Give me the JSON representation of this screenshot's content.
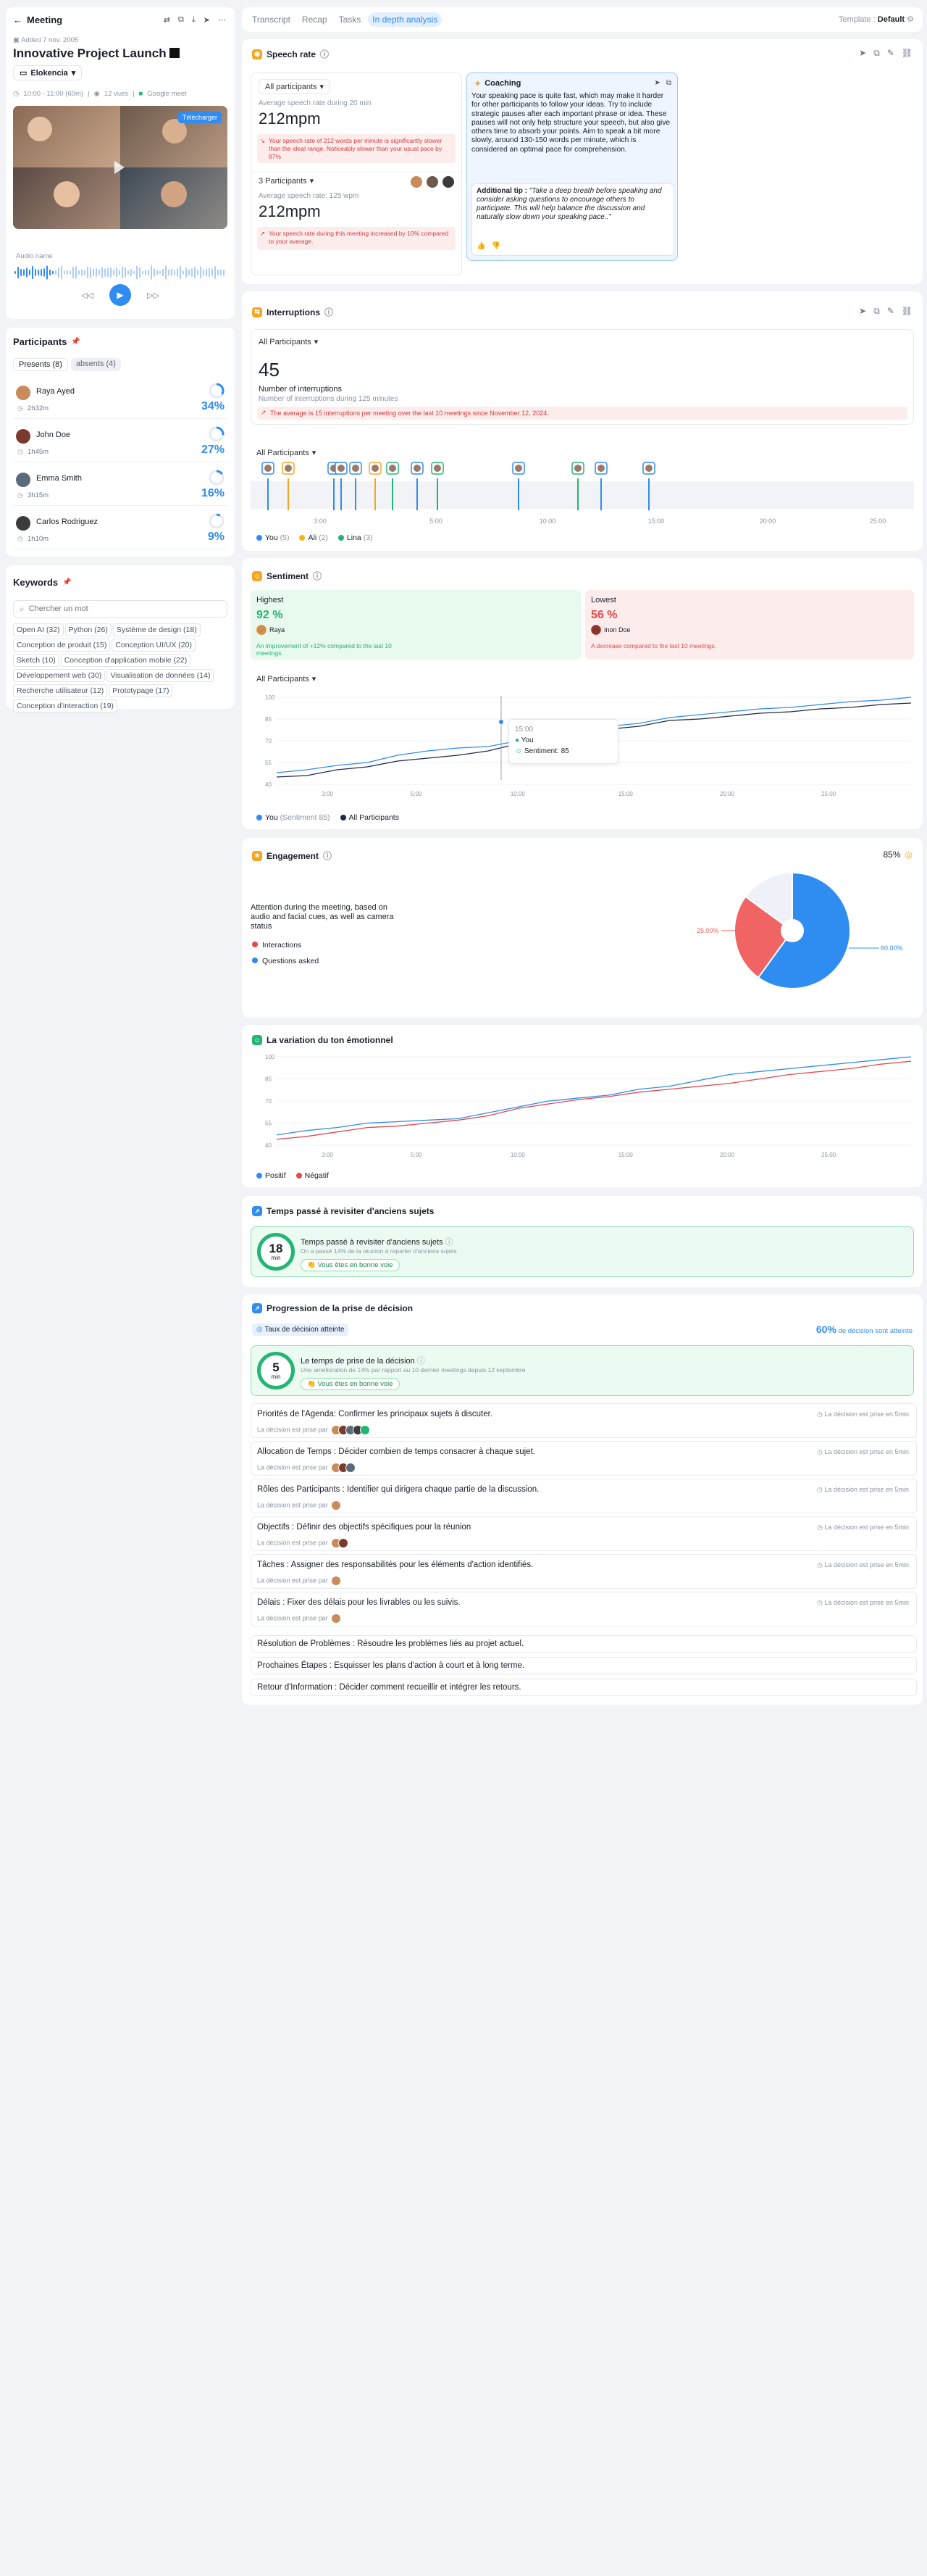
{
  "sidebar": {
    "back_label": "Meeting",
    "added": "Added 7 nov. 2005",
    "title": "Innovative Project Launch",
    "org": "Elokencia",
    "meta_time": "10:00 - 11:00 (60m)",
    "meta_views": "12 vues",
    "meta_source": "Google meet",
    "download": "Télécharger",
    "audio_label": "Audio name"
  },
  "participants": {
    "title": "Participants",
    "tab_present": "Presents (8)",
    "tab_absent": "absents (4)",
    "items": [
      {
        "name": "Raya Ayed",
        "time": "2h32m",
        "pct": "34%",
        "fill": 0.34,
        "color": "#c98b5a"
      },
      {
        "name": "John Doe",
        "time": "1h45m",
        "pct": "27%",
        "fill": 0.27,
        "color": "#7a3b2e"
      },
      {
        "name": "Emma Smith",
        "time": "3h15m",
        "pct": "16%",
        "fill": 0.16,
        "color": "#5a6b7c"
      },
      {
        "name": "Carlos Rodriguez",
        "time": "1h10m",
        "pct": "9%",
        "fill": 0.09,
        "color": "#3b3b3b"
      }
    ]
  },
  "keywords": {
    "title": "Keywords",
    "placeholder": "Chercher un mot",
    "items": [
      "Open AI (32)",
      "Python (26)",
      "Système de design (18)",
      "Conception de produit (15)",
      "Conception UI/UX (20)",
      "Sketch (10)",
      "Conception d'application mobile (22)",
      "Développement web (30)",
      "Visualisation de données (14)",
      "Recherche utilisateur (12)",
      "Prototypage (17)",
      "Conception d'interaction (19)"
    ]
  },
  "tabs": {
    "items": [
      "Transcript",
      "Recap",
      "Tasks",
      "In depth analysis"
    ],
    "template_label": "Template :",
    "template_value": "Default"
  },
  "speech": {
    "title": "Speech rate",
    "all_label": "All participants",
    "avg_label": "Average speech rate during 20 min",
    "value": "212mpm",
    "warn": "Your speech rate of 212 words per minute is significantly slower than the ideal range. Noticeably slower than your usual pace by 87%",
    "p3_label": "3 Participants",
    "avg2_label": "Average speech rate: 125 wpm",
    "value2": "212mpm",
    "warn2": "Your speech rate during this meeting increased by 10% compared to your average.",
    "coaching_title": "Coaching",
    "coaching_text": "Your speaking pace is quite fast, which may make it harder for other participants to follow your ideas. Try to include strategic pauses after each important phrase or idea. These pauses will not only help structure your speech, but also give others time to absorb your points. Aim to speak a bit more slowly, around 130-150 words per minute, which is considered an optimal pace for comprehension.",
    "tip_label": "Additional tip :",
    "tip_text": "\"Take a deep breath before speaking and consider asking questions to encourage others to participate. This will help balance the discussion and naturally slow down your speaking pace..\""
  },
  "interruptions": {
    "title": "Interruptions",
    "all_label": "All Participants",
    "value": "45",
    "label": "Number of interruptions",
    "sub": "Number of interruptions during 125 minutes",
    "warn": "The average is 15 interruptions per meeting over the last 10 meetings since November 12, 2024.",
    "all2_label": "All Participants",
    "ticks": [
      "3:00",
      "5:00",
      "10:00",
      "15:00",
      "20:00",
      "25:00"
    ],
    "legend": [
      {
        "name": "You",
        "count": "(5)",
        "color": "#2f8cf0"
      },
      {
        "name": "Ali",
        "count": "(2)",
        "color": "#f5b316"
      },
      {
        "name": "Lina",
        "count": "(3)",
        "color": "#22b573"
      }
    ]
  },
  "sentiment": {
    "title": "Sentiment",
    "highest_label": "Highest",
    "highest_value": "92 %",
    "highest_name": "Raya",
    "highest_note": "An improvement of +12% compared to the last 10 meetings.",
    "lowest_label": "Lowest",
    "lowest_value": "56 %",
    "lowest_name": "Inon Doe",
    "lowest_note": "A decrease compared to the last 10 meetings.",
    "all_label": "All Participants",
    "tooltip_time": "15:00",
    "tooltip_who": "You",
    "tooltip_val": "Sentiment: 85",
    "legend_you": "You",
    "legend_you_sub": "(Sentiment 85)",
    "legend_all": "All Participants"
  },
  "engagement": {
    "title": "Engagement",
    "pct": "85%",
    "desc": "Attention during the meeting, based on audio and facial cues, as well as camera status",
    "legend": [
      "Interactions",
      "Questions asked"
    ],
    "lbl_left": "25.00%",
    "lbl_right": "60.00%"
  },
  "ton": {
    "title": "La variation du ton émotionnel",
    "legend_pos": "Positif",
    "legend_neg": "Négatif"
  },
  "revisit": {
    "title": "Temps passé à revisiter d'anciens sujets",
    "value": "18",
    "unit": "min",
    "inner_title": "Temps passé à revisiter d'anciens sujets",
    "inner_sub": "On a passé 14% de la réunion à reparler d'anciens sujets",
    "badge": "Vous êtes en bonne voie"
  },
  "decision": {
    "title": "Progression de la prise de décision",
    "rate_label": "Taux de décision atteinte",
    "rate_value": "60%",
    "rate_note": "de décision sont atteinte",
    "value": "5",
    "unit": "min",
    "inner_title": "Le temps de prise de la décision",
    "inner_sub": "Une amélioration de 14% par rapport au 10 dernier meetings depuis 12 septembre",
    "badge": "Vous êtes en bonne voie",
    "rows": [
      {
        "title": "Priorités de l'Agenda: Confirmer les principaux sujets à discuter.",
        "sub": "La décision est prise par",
        "right": "La décision est prise en 5min"
      },
      {
        "title": "Allocation de Temps : Décider combien de temps consacrer à chaque sujet.",
        "sub": "La décision est prise par",
        "right": "La décision est prise en 5min"
      },
      {
        "title": "Rôles des Participants : Identifier qui dirigera chaque partie de la discussion.",
        "sub": "La décision est prise par",
        "right": "La décision est prise en 5min"
      },
      {
        "title": "Objectifs : Définir des objectifs spécifiques pour la réunion",
        "sub": "La décision est prise par",
        "right": "La décision est prise en 5min"
      },
      {
        "title": "Tâches : Assigner des responsabilités pour les éléments d'action identifiés.",
        "sub": "La décision est prise par",
        "right": "La décision est prise en 5min"
      },
      {
        "title": "Délais : Fixer des délais pour les livrables ou les suivis.",
        "sub": "La décision est prise par",
        "right": "La décision est prise en 5min"
      }
    ],
    "simple": [
      "Résolution de Problèmes : Résoudre les problèmes liés au projet actuel.",
      "Prochaines Étapes : Esquisser les plans d'action à court et à long terme.",
      "Retour d'Information : Décider comment recueillir et intégrer les retours."
    ]
  },
  "colors": {
    "accent": "#2f8cf0",
    "green": "#22b573",
    "red": "#e5484d",
    "orange": "#f5a623"
  }
}
